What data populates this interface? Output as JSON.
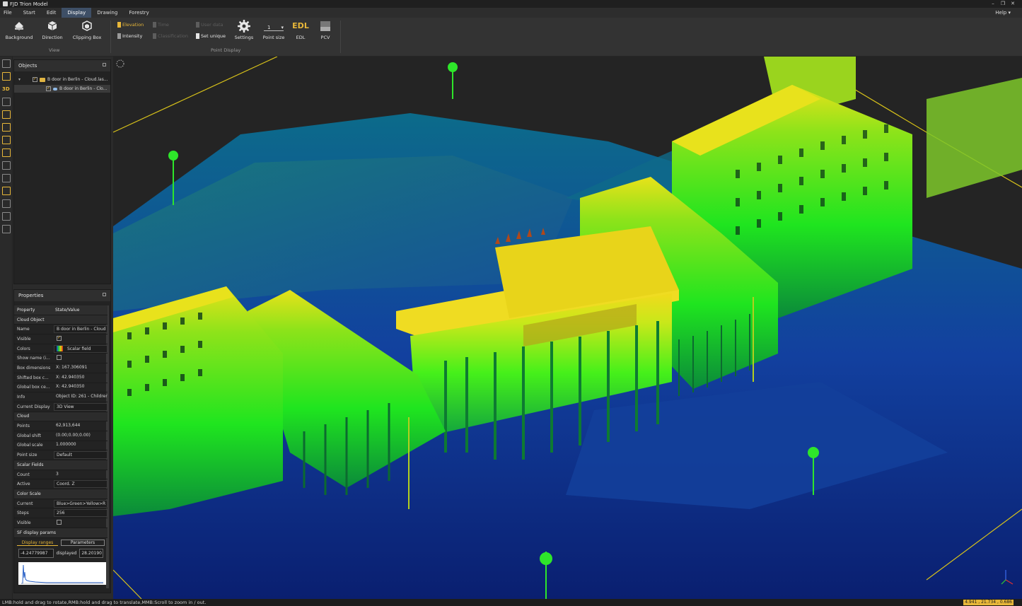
{
  "app": {
    "title": "FJD Trion Model"
  },
  "menu": {
    "items": [
      "File",
      "Start",
      "Edit",
      "Display",
      "Drawing",
      "Forestry"
    ],
    "active": "Display",
    "help": "Help"
  },
  "ribbon": {
    "view_group": {
      "label": "View",
      "background": "Background",
      "direction": "Direction",
      "clipping_box": "Clipping Box"
    },
    "point_display_group": {
      "label": "Point Display",
      "elevation": "Elevation",
      "time": "Time",
      "user_data": "User data",
      "intensity": "Intensity",
      "classification": "Classification",
      "set_unique": "Set unique",
      "settings": "Settings",
      "point_size_value": "1",
      "point_size": "Point size",
      "edl_icon": "EDL",
      "edl": "EDL",
      "pcv": "PCV"
    }
  },
  "objects_panel": {
    "title": "Objects",
    "items": [
      {
        "label": "B door in Berlin - Cloud.las..."
      },
      {
        "label": "B door in Berlin - Clo..."
      }
    ]
  },
  "properties_panel": {
    "title": "Properties",
    "col_property": "Property",
    "col_value": "State/Value",
    "sections": {
      "cloud_object": "Cloud Object",
      "cloud": "Cloud",
      "scalar_fields": "Scalar Fields",
      "color_scale": "Color Scale",
      "sf_display": "SF display params"
    },
    "rows": {
      "name": {
        "k": "Name",
        "v": "B door in Berlin - Cloud -"
      },
      "visible": {
        "k": "Visible"
      },
      "colors": {
        "k": "Colors",
        "v": "Scalar field"
      },
      "show_name": {
        "k": "Show name (i..."
      },
      "box_dimensions": {
        "k": "Box dimensions",
        "v": "X: 167.306091"
      },
      "shifted_box": {
        "k": "Shifted box c...",
        "v": "X: 42.940350"
      },
      "global_box": {
        "k": "Global box ce...",
        "v": "X: 42.940350"
      },
      "info": {
        "k": "Info",
        "v": "Object ID: 261 - Childrer"
      },
      "current_display": {
        "k": "Current Display",
        "v": "3D View"
      },
      "points": {
        "k": "Points",
        "v": "62,913,644"
      },
      "global_shift": {
        "k": "Global shift",
        "v": "(0.00;0.00;0.00)"
      },
      "global_scale": {
        "k": "Global scale",
        "v": "1.000000"
      },
      "point_size": {
        "k": "Point size",
        "v": "Default"
      },
      "count": {
        "k": "Count",
        "v": "3"
      },
      "active": {
        "k": "Active",
        "v": "Coord. Z"
      },
      "current": {
        "k": "Current",
        "v": "Blue>Green>Yellow>R"
      },
      "steps": {
        "k": "Steps",
        "v": "256"
      },
      "cs_visible": {
        "k": "Visible"
      }
    },
    "display_ranges_tab": "Display ranges",
    "parameters_tab": "Parameters",
    "range_min": "-4.24779987",
    "displayed_label": "displayed",
    "range_max": "28.20190"
  },
  "status": {
    "message": "LMB:hold and drag to rotate,RMB:hold and drag to translate,MMB:Scroll to zoom in / out.",
    "coords": "4.941 , 21.734 , 0.686"
  },
  "colors": {
    "accent": "#e8b739",
    "menu_active": "#3e4f66"
  }
}
